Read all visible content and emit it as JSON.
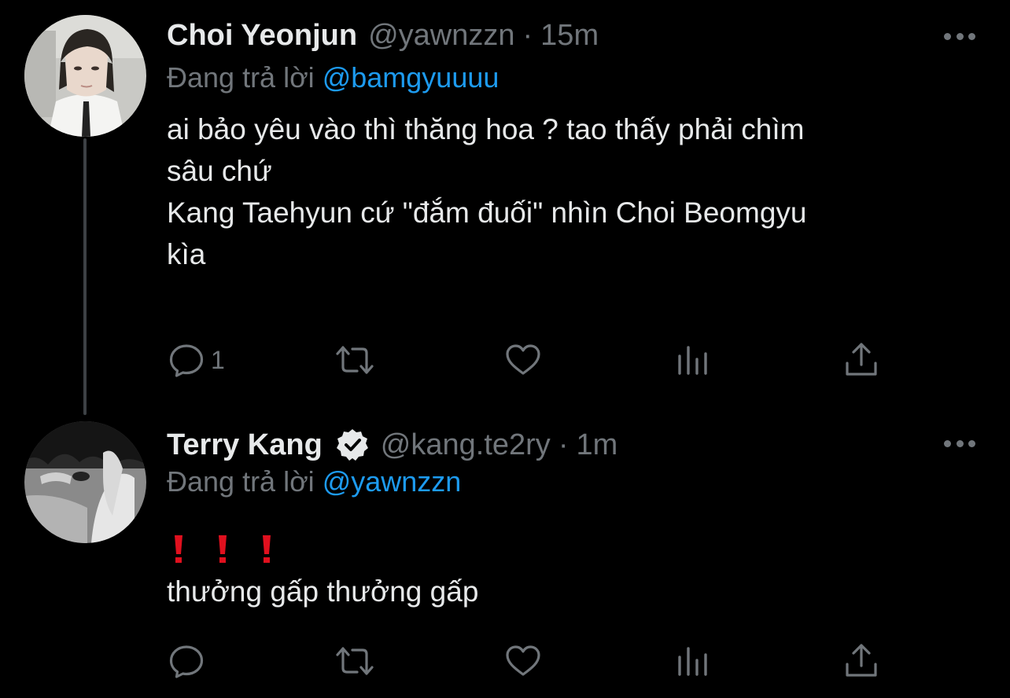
{
  "tweets": [
    {
      "name": "Choi Yeonjun",
      "handle": "@yawnzzn",
      "separator": "·",
      "time": "15m",
      "verified": false,
      "reply_prefix": "Đang trả lời",
      "reply_to": "@bamgyuuuu",
      "text_lines": [
        "ai bảo yêu vào thì thăng hoa ? tao thấy phải chìm",
        "sâu chứ",
        "Kang Taehyun cứ \"đắm đuối\" nhìn Choi Beomgyu",
        "kìa"
      ],
      "reply_count": "1"
    },
    {
      "name": "Terry Kang",
      "handle": "@kang.te2ry",
      "separator": "·",
      "time": "1m",
      "verified": true,
      "reply_prefix": "Đang trả lời",
      "reply_to": "@yawnzzn",
      "emoji": [
        "red-exclamation",
        "red-exclamation",
        "red-exclamation"
      ],
      "text_lines": [
        "thưởng gấp thưởng gấp"
      ],
      "reply_count": ""
    }
  ],
  "colors": {
    "background": "#000000",
    "primary_text": "#e7e9ea",
    "secondary_text": "#71767b",
    "mention": "#1d9bf0",
    "thread_line": "#3d4145",
    "exclamation": "#e0101e"
  }
}
